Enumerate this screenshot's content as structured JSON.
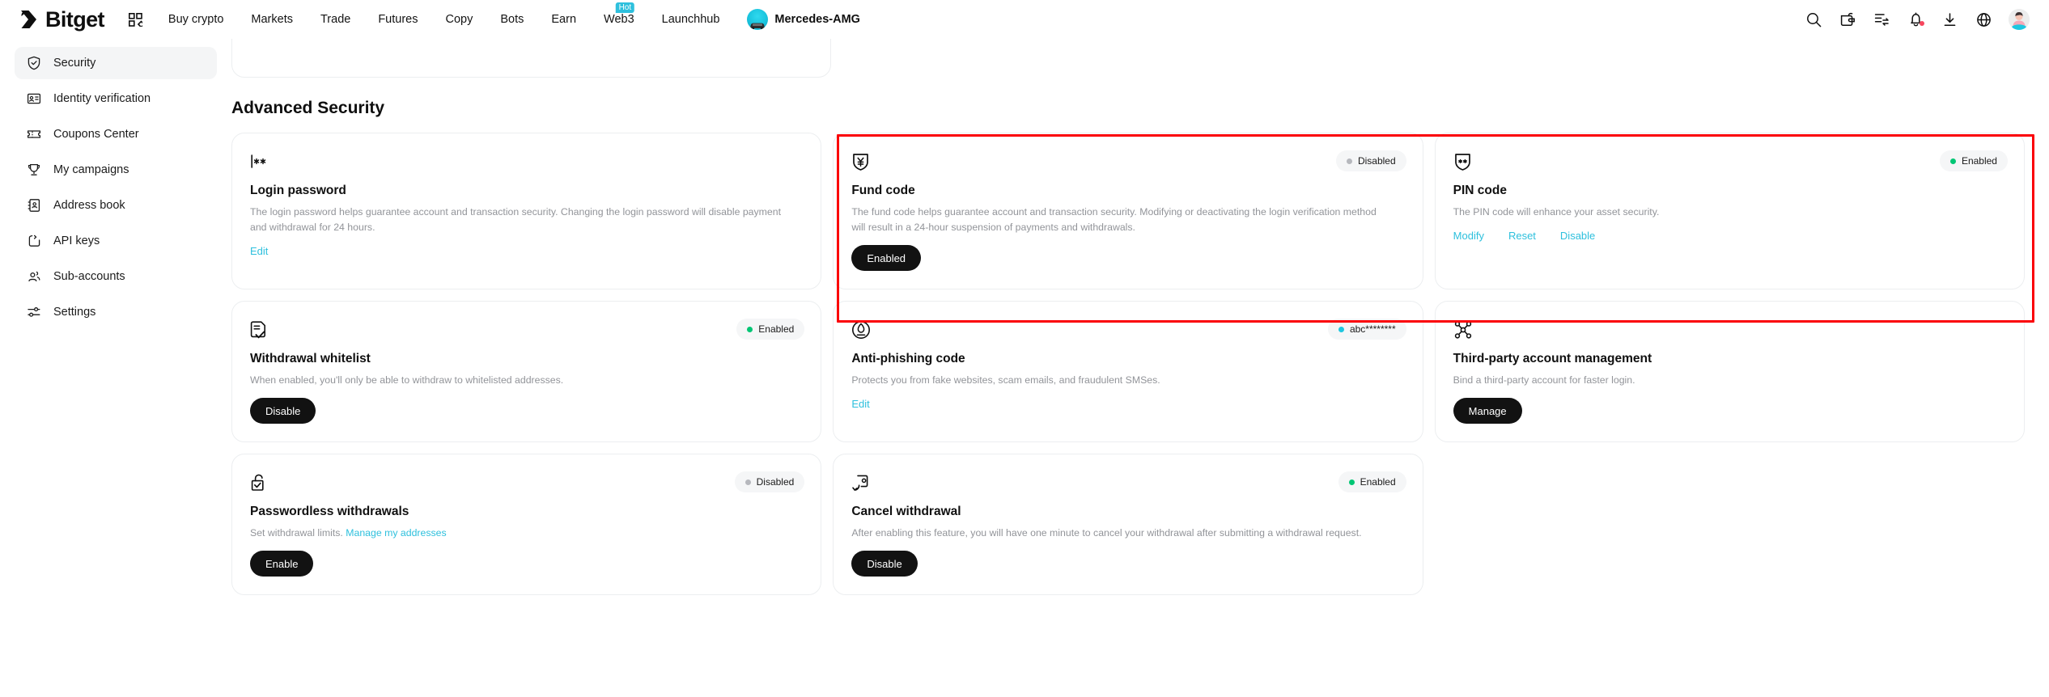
{
  "header": {
    "brand": "Bitget",
    "grid_icon": "apps-grid-icon",
    "nav": [
      {
        "label": "Buy crypto"
      },
      {
        "label": "Markets"
      },
      {
        "label": "Trade"
      },
      {
        "label": "Futures"
      },
      {
        "label": "Copy"
      },
      {
        "label": "Bots"
      },
      {
        "label": "Earn"
      },
      {
        "label": "Web3",
        "badge": "Hot"
      },
      {
        "label": "Launchhub"
      }
    ],
    "promo": {
      "label": "Mercedes-AMG",
      "icon": "amg-car-icon"
    },
    "icons": [
      {
        "name": "search-icon"
      },
      {
        "name": "wallet-icon"
      },
      {
        "name": "orders-icon"
      },
      {
        "name": "notifications-bell-icon",
        "has_dot": true
      },
      {
        "name": "download-icon"
      },
      {
        "name": "language-globe-icon"
      },
      {
        "name": "user-avatar"
      }
    ]
  },
  "sidebar": {
    "items": [
      {
        "label": "Security",
        "icon": "shield-check-icon",
        "active": true
      },
      {
        "label": "Identity verification",
        "icon": "id-card-icon",
        "active": false
      },
      {
        "label": "Coupons Center",
        "icon": "ticket-icon",
        "active": false
      },
      {
        "label": "My campaigns",
        "icon": "trophy-icon",
        "active": false
      },
      {
        "label": "Address book",
        "icon": "address-book-icon",
        "active": false
      },
      {
        "label": "API keys",
        "icon": "code-brackets-icon",
        "active": false
      },
      {
        "label": "Sub-accounts",
        "icon": "users-icon",
        "active": false
      },
      {
        "label": "Settings",
        "icon": "sliders-icon",
        "active": false
      }
    ]
  },
  "main": {
    "section_title": "Advanced Security",
    "cards": [
      {
        "id": "login-password",
        "icon": "password-asterisk-icon",
        "title": "Login password",
        "desc": "The login password helps guarantee account and transaction security. Changing the login password will disable payment and withdrawal for 24 hours.",
        "status": null,
        "actions": [
          {
            "type": "link",
            "label": "Edit"
          }
        ]
      },
      {
        "id": "fund-code",
        "icon": "shield-yen-icon",
        "title": "Fund code",
        "desc": "The fund code helps guarantee account and transaction security. Modifying or deactivating the login verification method will result in a 24-hour suspension of payments and withdrawals.",
        "status": {
          "label": "Disabled",
          "color": "#b6b8bd"
        },
        "actions": [
          {
            "type": "button",
            "label": "Enabled"
          }
        ]
      },
      {
        "id": "pin-code",
        "icon": "shield-pin-icon",
        "title": "PIN code",
        "desc": "The PIN code will enhance your asset security.",
        "status": {
          "label": "Enabled",
          "color": "#00c674"
        },
        "actions": [
          {
            "type": "link",
            "label": "Modify"
          },
          {
            "type": "link",
            "label": "Reset"
          },
          {
            "type": "link",
            "label": "Disable"
          }
        ]
      },
      {
        "id": "withdrawal-whitelist",
        "icon": "document-check-icon",
        "title": "Withdrawal whitelist",
        "desc": "When enabled, you'll only be able to withdraw to whitelisted addresses.",
        "status": {
          "label": "Enabled",
          "color": "#00c674"
        },
        "actions": [
          {
            "type": "button",
            "label": "Disable"
          }
        ]
      },
      {
        "id": "anti-phishing-code",
        "icon": "anti-phishing-icon",
        "title": "Anti-phishing code",
        "desc": "Protects you from fake websites, scam emails, and fraudulent SMSes.",
        "status": {
          "label": "abc********",
          "color": "#1ec7e0"
        },
        "actions": [
          {
            "type": "link",
            "label": "Edit"
          }
        ]
      },
      {
        "id": "third-party-account-management",
        "icon": "network-nodes-icon",
        "title": "Third-party account management",
        "desc": "Bind a third-party account for faster login.",
        "status": null,
        "actions": [
          {
            "type": "button",
            "label": "Manage"
          }
        ]
      },
      {
        "id": "passwordless-withdrawals",
        "icon": "unlock-check-icon",
        "title": "Passwordless withdrawals",
        "desc": "Set withdrawal limits. ",
        "desc_link": "Manage my addresses",
        "status": {
          "label": "Disabled",
          "color": "#b6b8bd"
        },
        "actions": [
          {
            "type": "button",
            "label": "Enable"
          }
        ]
      },
      {
        "id": "cancel-withdrawal",
        "icon": "undo-withdrawal-icon",
        "title": "Cancel withdrawal",
        "desc": "After enabling this feature, you will have one minute to cancel your withdrawal after submitting a withdrawal request.",
        "status": {
          "label": "Enabled",
          "color": "#00c674"
        },
        "actions": [
          {
            "type": "button",
            "label": "Disable"
          }
        ]
      }
    ]
  },
  "annotation": {
    "highlight_color": "#fb0007"
  }
}
